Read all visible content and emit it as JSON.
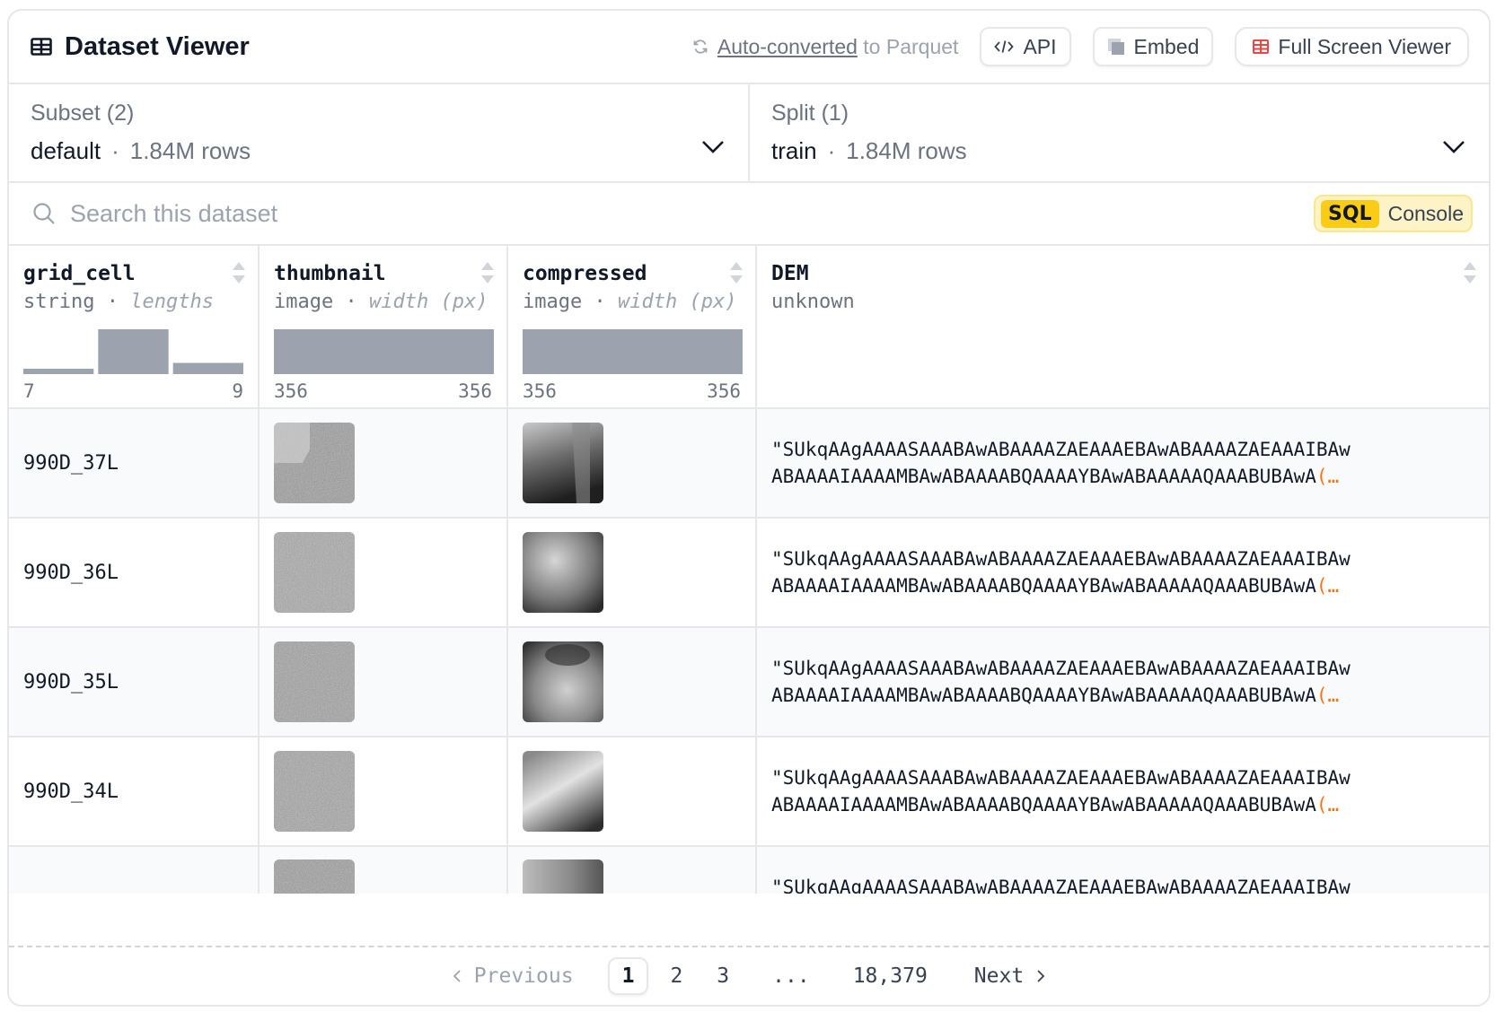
{
  "header": {
    "title": "Dataset Viewer",
    "parquet_link": "Auto-converted",
    "parquet_suffix": " to Parquet",
    "api_label": "API",
    "embed_label": "Embed",
    "fullscreen_label": "Full Screen Viewer"
  },
  "subset": {
    "label": "Subset (2)",
    "value": "default",
    "rows": "1.84M rows"
  },
  "split": {
    "label": "Split (1)",
    "value": "train",
    "rows": "1.84M rows"
  },
  "search": {
    "placeholder": "Search this dataset"
  },
  "sql": {
    "badge": "SQL",
    "label": "Console"
  },
  "columns": [
    {
      "name": "grid_cell",
      "type": "string",
      "sub": "lengths",
      "min": "7",
      "max": "9",
      "hist": [
        0.12,
        1.0,
        0.25
      ]
    },
    {
      "name": "thumbnail",
      "type": "image",
      "sub": "width (px)",
      "min": "356",
      "max": "356",
      "hist": [
        1.0
      ]
    },
    {
      "name": "compressed",
      "type": "image",
      "sub": "width (px)",
      "min": "356",
      "max": "356",
      "hist": [
        1.0
      ]
    },
    {
      "name": "DEM",
      "type": "unknown"
    }
  ],
  "rows": [
    {
      "grid_cell": "990D_37L",
      "dem_line1": "\"SUkqAAgAAAASAAABAwABAAAAZAEAAAEBAwABAAAAZAEAAAIBAw",
      "dem_line2": "ABAAAAIAAAAMBAwABAAAABQAAAAYBAwABAAAAAQAAABUBAwA",
      "dem_more": "(…"
    },
    {
      "grid_cell": "990D_36L",
      "dem_line1": "\"SUkqAAgAAAASAAABAwABAAAAZAEAAAEBAwABAAAAZAEAAAIBAw",
      "dem_line2": "ABAAAAIAAAAMBAwABAAAABQAAAAYBAwABAAAAAQAAABUBAwA",
      "dem_more": "(…"
    },
    {
      "grid_cell": "990D_35L",
      "dem_line1": "\"SUkqAAgAAAASAAABAwABAAAAZAEAAAEBAwABAAAAZAEAAAIBAw",
      "dem_line2": "ABAAAAIAAAAMBAwABAAAABQAAAAYBAwABAAAAAQAAABUBAwA",
      "dem_more": "(…"
    },
    {
      "grid_cell": "990D_34L",
      "dem_line1": "\"SUkqAAgAAAASAAABAwABAAAAZAEAAAEBAwABAAAAZAEAAAIBAw",
      "dem_line2": "ABAAAAIAAAAMBAwABAAAABQAAAAYBAwABAAAAAQAAABUBAwA",
      "dem_more": "(…"
    },
    {
      "grid_cell": "",
      "dem_line1": "\"SUkqAAgAAAASAAABAwABAAAAZAEAAAEBAwABAAAAZAEAAAIBAw",
      "dem_line2": "",
      "dem_more": ""
    }
  ],
  "pagination": {
    "previous": "Previous",
    "next": "Next",
    "pages": [
      "1",
      "2",
      "3",
      "...",
      "18,379"
    ],
    "current": "1"
  },
  "colors": {
    "accent_yellow": "#facc15",
    "hist_bar": "#9ca3af",
    "border": "#e5e7eb",
    "orange": "#f97316"
  }
}
